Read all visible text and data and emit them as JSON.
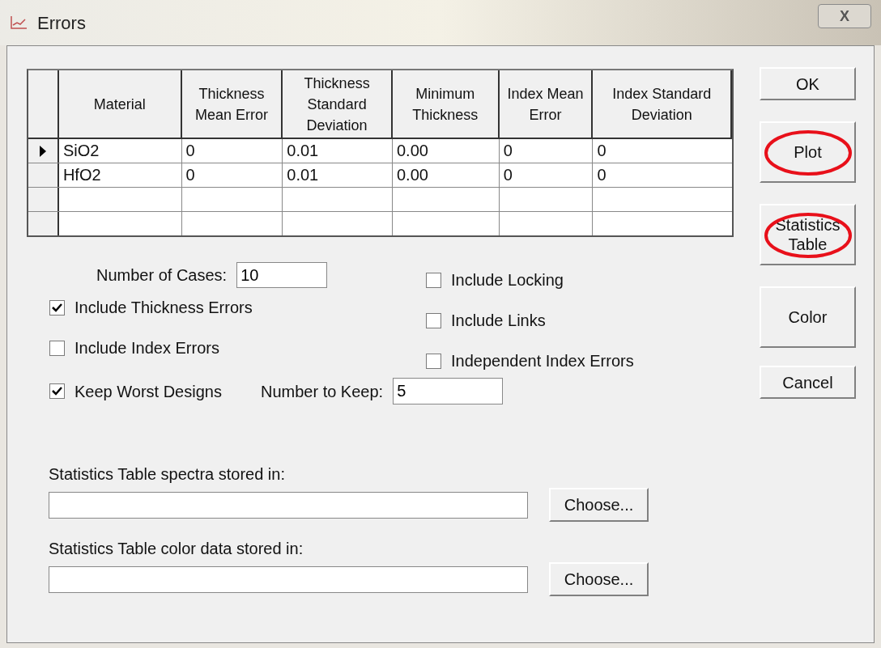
{
  "window": {
    "title": "Errors",
    "close": "X"
  },
  "table": {
    "columns": [
      "Material",
      "Thickness Mean Error",
      "Thickness Standard Deviation",
      "Minimum Thickness",
      "Index Mean Error",
      "Index Standard Deviation"
    ],
    "rows": [
      {
        "selected": true,
        "cells": [
          "SiO2",
          "0",
          "0.01",
          "0.00",
          "0",
          "0"
        ]
      },
      {
        "selected": false,
        "cells": [
          "HfO2",
          "0",
          "0.01",
          "0.00",
          "0",
          "0"
        ]
      },
      {
        "selected": false
      },
      {
        "selected": false
      }
    ]
  },
  "buttons": [
    {
      "label": "OK",
      "circled": false,
      "kind": "short"
    },
    {
      "label": "Plot",
      "circled": true,
      "kind": "tall"
    },
    {
      "label": "Statistics Table",
      "circled": true,
      "kind": "tall"
    },
    {
      "label": "Color",
      "circled": false,
      "kind": "tall"
    },
    {
      "label": "Cancel",
      "circled": false,
      "kind": "short"
    }
  ],
  "number_of_cases": {
    "label": "Number of Cases:",
    "value": "10"
  },
  "left_options": [
    {
      "label": "Include Thickness Errors",
      "checked": true
    },
    {
      "label": "Include Index Errors",
      "checked": false
    },
    {
      "label": "Keep Worst Designs",
      "checked": true
    }
  ],
  "right_options": [
    {
      "label": "Include Locking",
      "checked": false
    },
    {
      "label": "Include Links",
      "checked": false
    },
    {
      "label": "Independent Index Errors",
      "checked": false
    }
  ],
  "number_to_keep": {
    "label": "Number to Keep:",
    "value": "5"
  },
  "files": [
    {
      "label": "Statistics Table spectra stored in:",
      "button": "Choose..."
    },
    {
      "label": "Statistics Table color data stored in:",
      "button": "Choose..."
    }
  ]
}
